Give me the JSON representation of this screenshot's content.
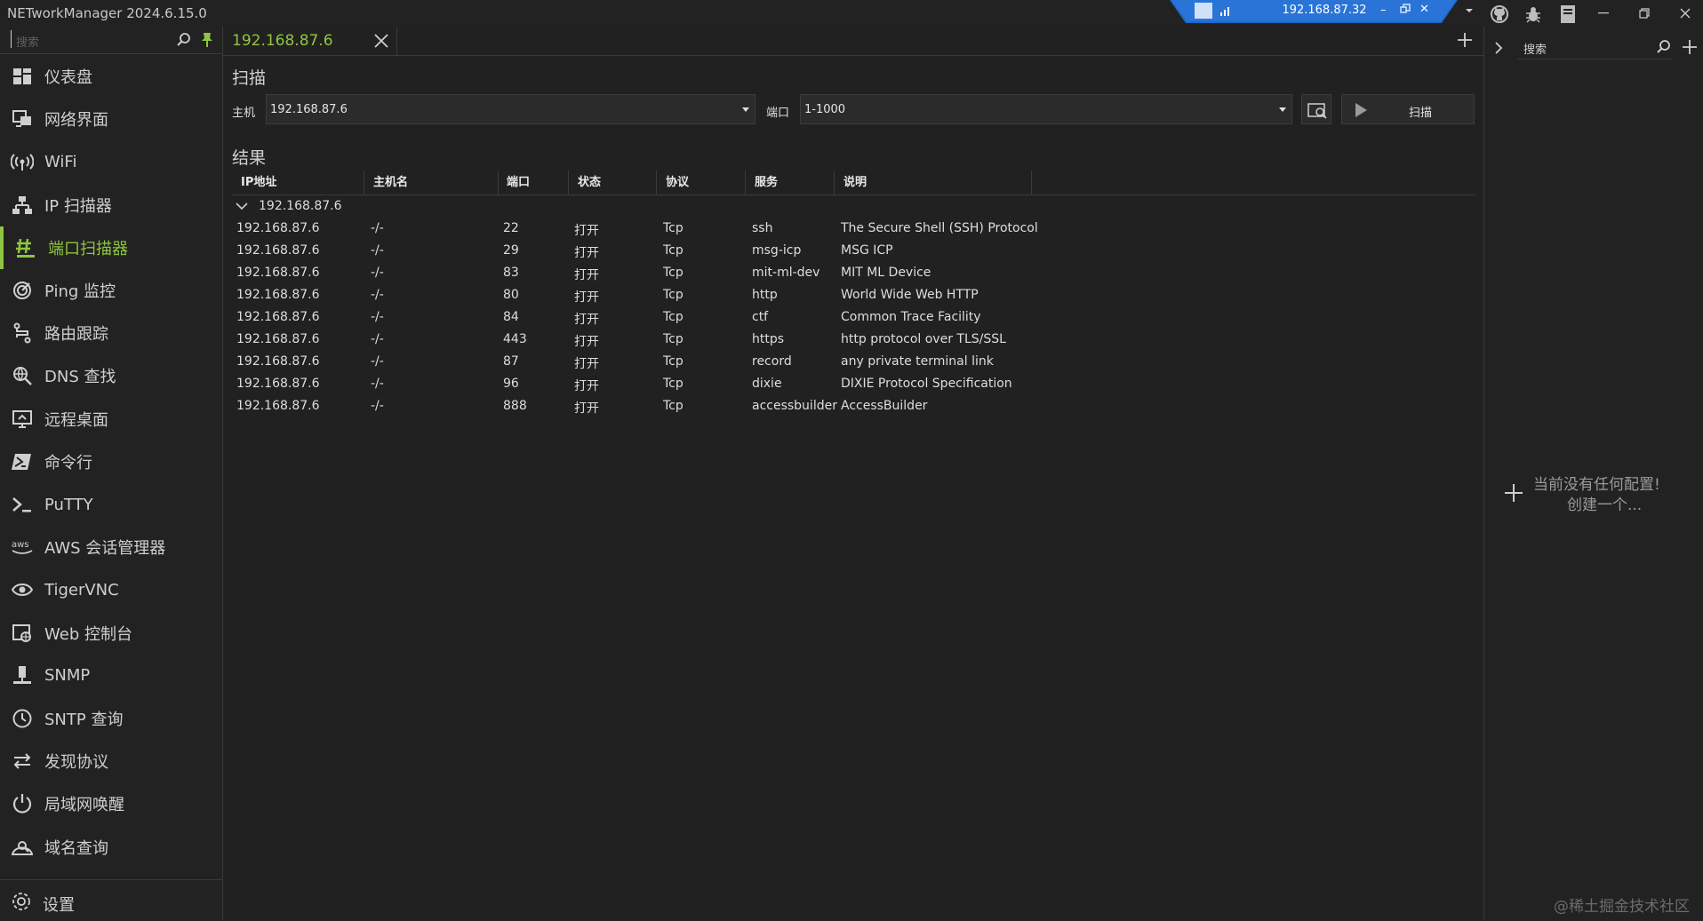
{
  "app": {
    "title": "NETworkManager 2024.6.15.0"
  },
  "remote_bar": {
    "ip": "192.168.87.32"
  },
  "sidebar": {
    "search_placeholder": "搜索",
    "items": [
      {
        "label": "仪表盘",
        "icon": "dashboard-icon"
      },
      {
        "label": "网络界面",
        "icon": "network-interface-icon"
      },
      {
        "label": "WiFi",
        "icon": "wifi-icon"
      },
      {
        "label": "IP 扫描器",
        "icon": "ip-scanner-icon"
      },
      {
        "label": "端口扫描器",
        "icon": "port-scanner-icon",
        "active": true
      },
      {
        "label": "Ping 监控",
        "icon": "ping-monitor-icon"
      },
      {
        "label": "路由跟踪",
        "icon": "traceroute-icon"
      },
      {
        "label": "DNS 查找",
        "icon": "dns-lookup-icon"
      },
      {
        "label": "远程桌面",
        "icon": "remote-desktop-icon"
      },
      {
        "label": "命令行",
        "icon": "powershell-icon"
      },
      {
        "label": "PuTTY",
        "icon": "putty-icon"
      },
      {
        "label": "AWS 会话管理器",
        "icon": "aws-icon"
      },
      {
        "label": "TigerVNC",
        "icon": "eye-icon"
      },
      {
        "label": "Web 控制台",
        "icon": "web-console-icon"
      },
      {
        "label": "SNMP",
        "icon": "snmp-icon"
      },
      {
        "label": "SNTP 查询",
        "icon": "clock-icon"
      },
      {
        "label": "发现协议",
        "icon": "swap-arrows-icon"
      },
      {
        "label": "局域网唤醒",
        "icon": "power-icon"
      },
      {
        "label": "域名查询",
        "icon": "whois-icon"
      }
    ],
    "settings_label": "设置"
  },
  "tab": {
    "label": "192.168.87.6"
  },
  "scan": {
    "heading": "扫描",
    "host_label": "主机",
    "host_value": "192.168.87.6",
    "port_label": "端口",
    "port_value": "1-1000",
    "scan_button": "扫描"
  },
  "results": {
    "heading": "结果",
    "columns": [
      "IP地址",
      "主机名",
      "端口",
      "状态",
      "协议",
      "服务",
      "说明"
    ],
    "group": "192.168.87.6",
    "rows": [
      [
        "192.168.87.6",
        "-/-",
        "22",
        "打开",
        "Tcp",
        "ssh",
        "The Secure Shell (SSH) Protocol"
      ],
      [
        "192.168.87.6",
        "-/-",
        "29",
        "打开",
        "Tcp",
        "msg-icp",
        "MSG ICP"
      ],
      [
        "192.168.87.6",
        "-/-",
        "83",
        "打开",
        "Tcp",
        "mit-ml-dev",
        "MIT ML Device"
      ],
      [
        "192.168.87.6",
        "-/-",
        "80",
        "打开",
        "Tcp",
        "http",
        "World Wide Web HTTP"
      ],
      [
        "192.168.87.6",
        "-/-",
        "84",
        "打开",
        "Tcp",
        "ctf",
        "Common Trace Facility"
      ],
      [
        "192.168.87.6",
        "-/-",
        "443",
        "打开",
        "Tcp",
        "https",
        "http protocol over TLS/SSL"
      ],
      [
        "192.168.87.6",
        "-/-",
        "87",
        "打开",
        "Tcp",
        "record",
        "any private terminal link"
      ],
      [
        "192.168.87.6",
        "-/-",
        "96",
        "打开",
        "Tcp",
        "dixie",
        "DIXIE Protocol Specification"
      ],
      [
        "192.168.87.6",
        "-/-",
        "888",
        "打开",
        "Tcp",
        "accessbuilder",
        "AccessBuilder"
      ]
    ]
  },
  "profiles_panel": {
    "search_placeholder": "搜索",
    "empty_line1": "当前没有任何配置!",
    "empty_line2": "创建一个..."
  },
  "watermark": "@稀土掘金技术社区",
  "colors": {
    "accent": "#8ec63f",
    "background": "#222222",
    "remote_bar": "#1f66c9"
  }
}
